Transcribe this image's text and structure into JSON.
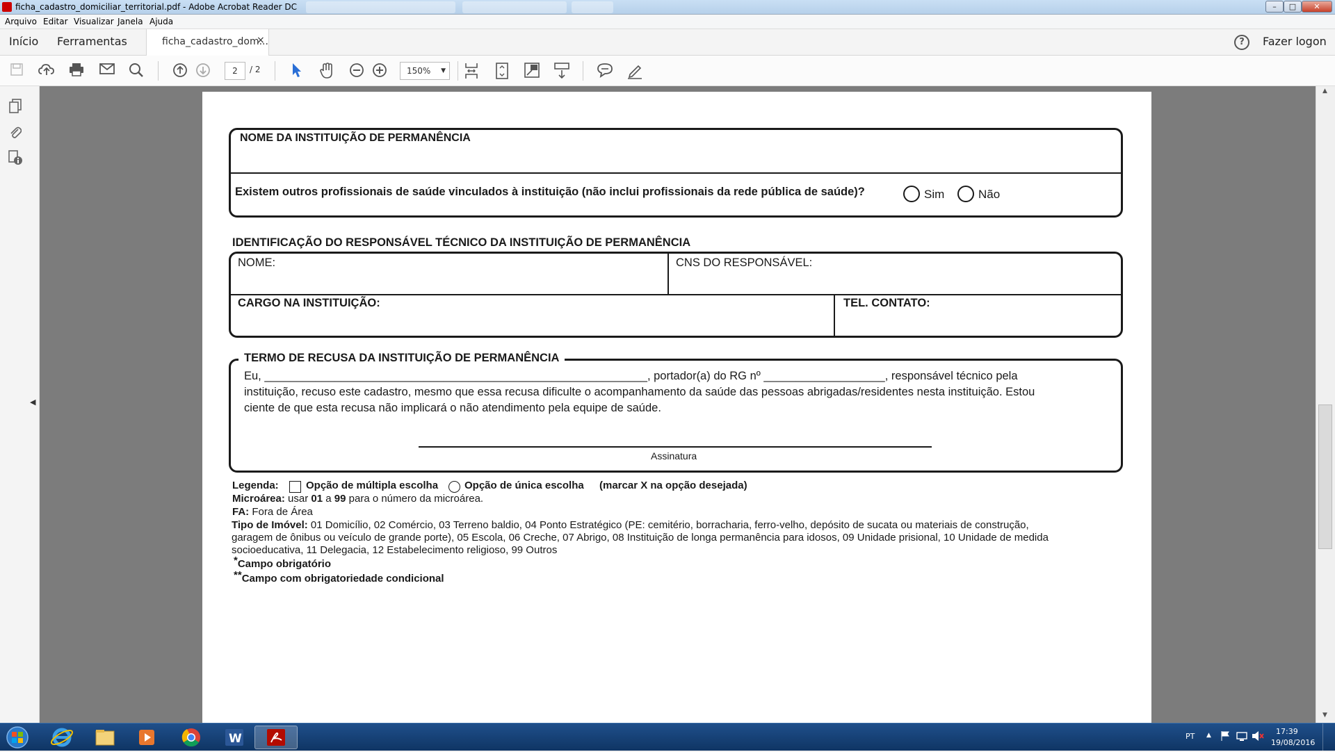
{
  "window": {
    "title": "ficha_cadastro_domiciliar_territorial.pdf - Adobe Acrobat Reader DC",
    "controls": {
      "minimize": "–",
      "maximize": "□",
      "close": "✕"
    }
  },
  "menubar": {
    "items": [
      "Arquivo",
      "Editar",
      "Visualizar",
      "Janela",
      "Ajuda"
    ]
  },
  "tabs": {
    "home": "Início",
    "tools": "Ferramentas",
    "document": "ficha_cadastro_dom...",
    "close": "×",
    "help": "?",
    "login": "Fazer logon"
  },
  "toolbar": {
    "page_current": "2",
    "page_total": "/ 2",
    "zoom": "150%",
    "zoom_arrow": "▼"
  },
  "form": {
    "nome_instituicao": "NOME DA INSTITUIÇÃO DE PERMANÊNCIA",
    "pergunta": "Existem outros profissionais de saúde vinculados à instituição (não inclui profissionais da rede pública de saúde)?",
    "sim": "Sim",
    "nao": "Não",
    "identificacao_titulo": "IDENTIFICAÇÃO DO RESPONSÁVEL TÉCNICO DA INSTITUIÇÃO DE PERMANÊNCIA",
    "nome": "NOME:",
    "cns": "CNS DO RESPONSÁVEL:",
    "cargo": "CARGO NA INSTITUIÇÃO:",
    "tel": "TEL. CONTATO:",
    "termo_titulo": "TERMO DE RECUSA DA INSTITUIÇÃO DE PERMANÊNCIA",
    "termo_linha1": "Eu, ____________________________________________________________, portador(a) do RG nº ___________________, responsável técnico pela",
    "termo_linha2": "instituição, recuso este cadastro, mesmo que essa recusa dificulte o acompanhamento da saúde das pessoas abrigadas/residentes nesta instituição. Estou",
    "termo_linha3": "ciente de que esta recusa não implicará o não atendimento pela equipe de saúde.",
    "assinatura": "Assinatura"
  },
  "legend": {
    "label": "Legenda:",
    "multipla": "Opção de múltipla escolha",
    "unica": "Opção de única escolha",
    "marcar": "(marcar X na opção desejada)",
    "microarea_label": "Microárea:",
    "microarea_text1": "usar",
    "microarea_01": "01",
    "microarea_text2": "a",
    "microarea_99": "99",
    "microarea_text3": "para o número da microárea.",
    "fa_label": "FA:",
    "fa_text": "Fora de Área",
    "tipo_label": "Tipo de Imóvel:",
    "tipo_line1": "01 Domicílio, 02 Comércio, 03 Terreno baldio, 04 Ponto Estratégico (PE: cemitério, borracharia, ferro-velho, depósito de sucata ou materiais de construção,",
    "tipo_line2": "garagem de ônibus ou veículo de grande porte), 05 Escola, 06 Creche, 07 Abrigo, 08 Instituição de longa permanência para idosos, 09 Unidade prisional, 10 Unidade de medida",
    "tipo_line3": "socioeducativa, 11 Delegacia, 12 Estabelecimento religioso, 99 Outros",
    "star1": "*",
    "obrigatorio": "Campo obrigatório",
    "star2": "**",
    "condicional": "Campo com obrigatoriedade condicional"
  },
  "taskbar": {
    "lang": "PT",
    "time": "17:39",
    "date": "19/08/2016"
  }
}
